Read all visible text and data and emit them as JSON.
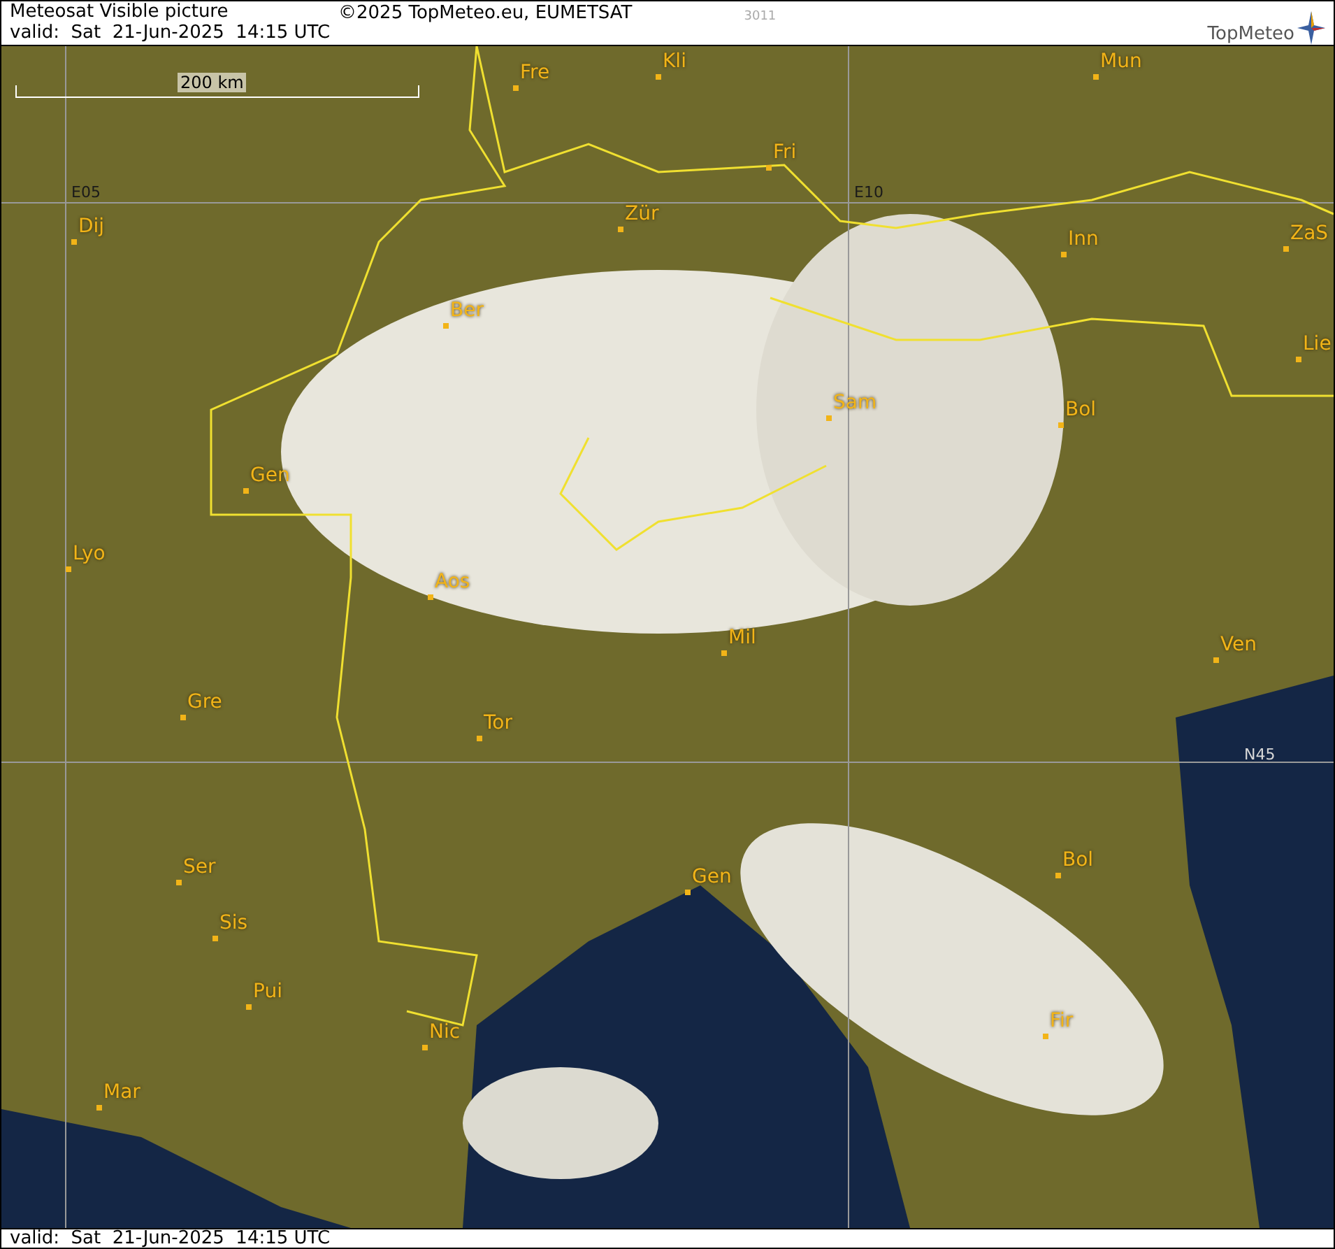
{
  "header": {
    "title": "Meteosat Visible picture",
    "valid": "valid:  Sat  21-Jun-2025  14:15 UTC",
    "copyright": "©2025 TopMeteo.eu, EUMETSAT",
    "code": "3011",
    "logo": "TopMeteo"
  },
  "map": {
    "scale_label": "200 km",
    "grid_labels": [
      {
        "label": "E05"
      },
      {
        "label": "E10"
      },
      {
        "label": "N45"
      }
    ],
    "places": [
      {
        "name": "Fre"
      },
      {
        "name": "Kli"
      },
      {
        "name": "Mun"
      },
      {
        "name": "Fri"
      },
      {
        "name": "Dij"
      },
      {
        "name": "Zür"
      },
      {
        "name": "Inn"
      },
      {
        "name": "ZaS"
      },
      {
        "name": "Ber"
      },
      {
        "name": "Lie"
      },
      {
        "name": "Sam"
      },
      {
        "name": "Bol"
      },
      {
        "name": "Gen"
      },
      {
        "name": "Lyo"
      },
      {
        "name": "Aos"
      },
      {
        "name": "Mil"
      },
      {
        "name": "Ven"
      },
      {
        "name": "Gre"
      },
      {
        "name": "Tor"
      },
      {
        "name": "Ser"
      },
      {
        "name": "Bol"
      },
      {
        "name": "Gen"
      },
      {
        "name": "Sis"
      },
      {
        "name": "Pui"
      },
      {
        "name": "Nic"
      },
      {
        "name": "Fir"
      },
      {
        "name": "Mar"
      }
    ]
  },
  "footer": {
    "valid": "valid:  Sat  21-Jun-2025  14:15 UTC"
  }
}
